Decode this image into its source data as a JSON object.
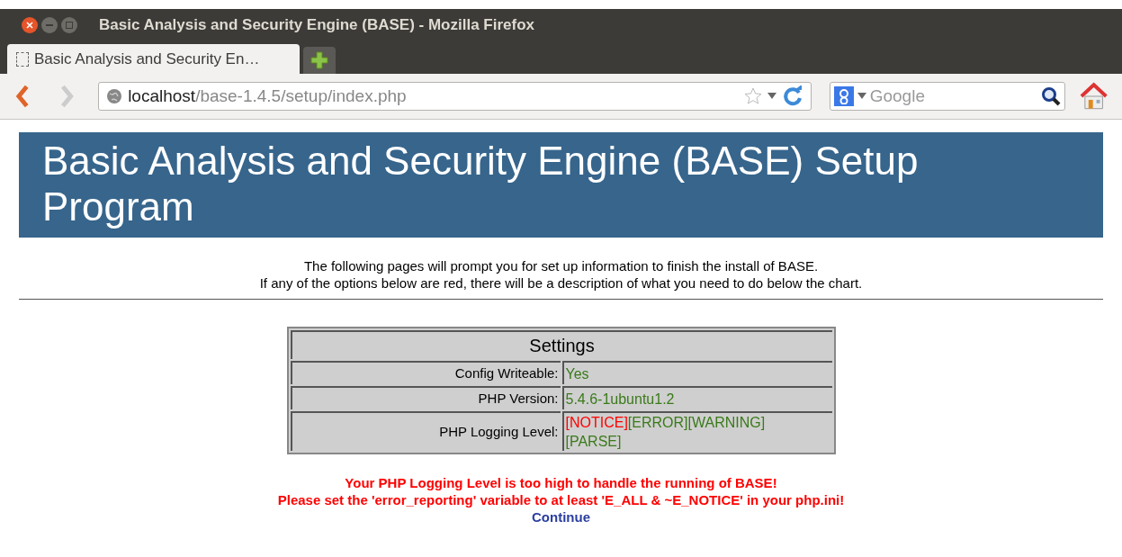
{
  "window": {
    "title": "Basic Analysis and Security Engine (BASE) - Mozilla Firefox"
  },
  "tabs": [
    {
      "label": "Basic Analysis and Security En…",
      "selected": true
    }
  ],
  "address_bar": {
    "host": "localhost",
    "path": "/base-1.4.5/setup/index.php"
  },
  "search": {
    "placeholder": "Google"
  },
  "page": {
    "heading": "Basic Analysis and Security Engine (BASE) Setup Program",
    "intro": [
      "The following pages will prompt you for set up information to finish the install of BASE.",
      "If any of the options below are red, there will be a description of what you need to do below the chart."
    ],
    "settings": {
      "title": "Settings",
      "rows": [
        {
          "label": "Config Writeable:",
          "values": [
            {
              "text": "Yes",
              "color": "#3a7a1a"
            }
          ]
        },
        {
          "label": "PHP Version:",
          "values": [
            {
              "text": "5.4.6-1ubuntu1.2",
              "color": "#3a7a1a"
            }
          ]
        },
        {
          "label": "PHP Logging Level:",
          "values": [
            {
              "text": "[NOTICE]",
              "color": "#ff0000"
            },
            {
              "text": "[ERROR]",
              "color": "#3a7a1a"
            },
            {
              "text": "[WARNING]",
              "color": "#3a7a1a"
            },
            {
              "text": "[PARSE]",
              "color": "#3a7a1a"
            }
          ]
        }
      ]
    },
    "errors": [
      "Your PHP Logging Level is too high to handle the running of BASE!",
      "Please set the 'error_reporting' variable to at least 'E_ALL & ~E_NOTICE' in your php.ini!"
    ],
    "link": "Continue"
  }
}
